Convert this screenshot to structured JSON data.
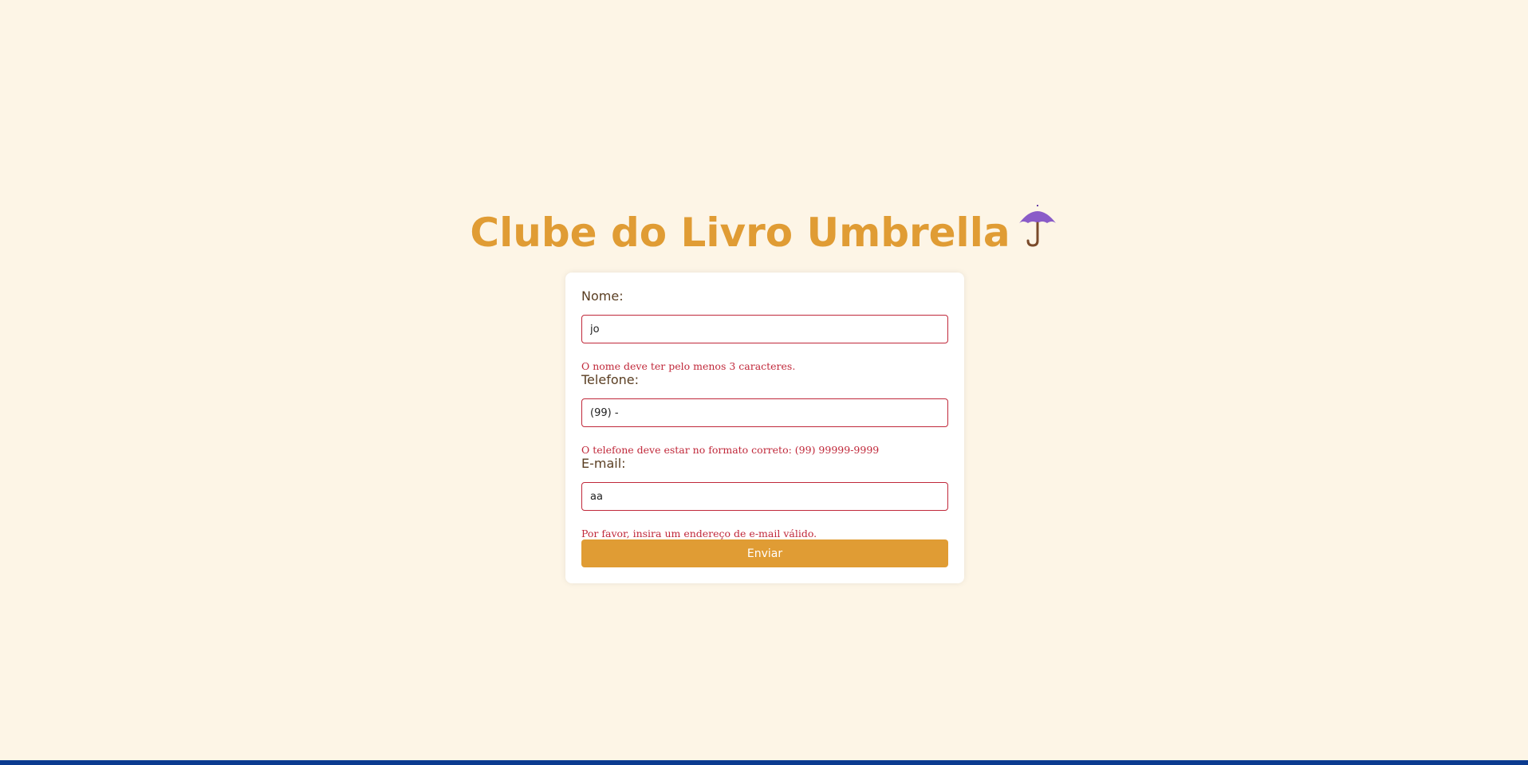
{
  "header": {
    "title": "Clube do Livro Umbrella",
    "icon": "umbrella-icon"
  },
  "form": {
    "fields": [
      {
        "label": "Nome:",
        "value": "jo",
        "error": "O nome deve ter pelo menos 3 caracteres."
      },
      {
        "label": "Telefone:",
        "value": "(99) -",
        "error": "O telefone deve estar no formato correto: (99) 99999-9999"
      },
      {
        "label": "E-mail:",
        "value": "aa",
        "error": "Por favor, insira um endereço de e-mail válido."
      }
    ],
    "submit_label": "Enviar"
  },
  "colors": {
    "background": "#fdf5e6",
    "accent": "#e09c34",
    "error": "#c0283a",
    "label": "#5a3e22",
    "umbrella": "#8a5cc8"
  }
}
